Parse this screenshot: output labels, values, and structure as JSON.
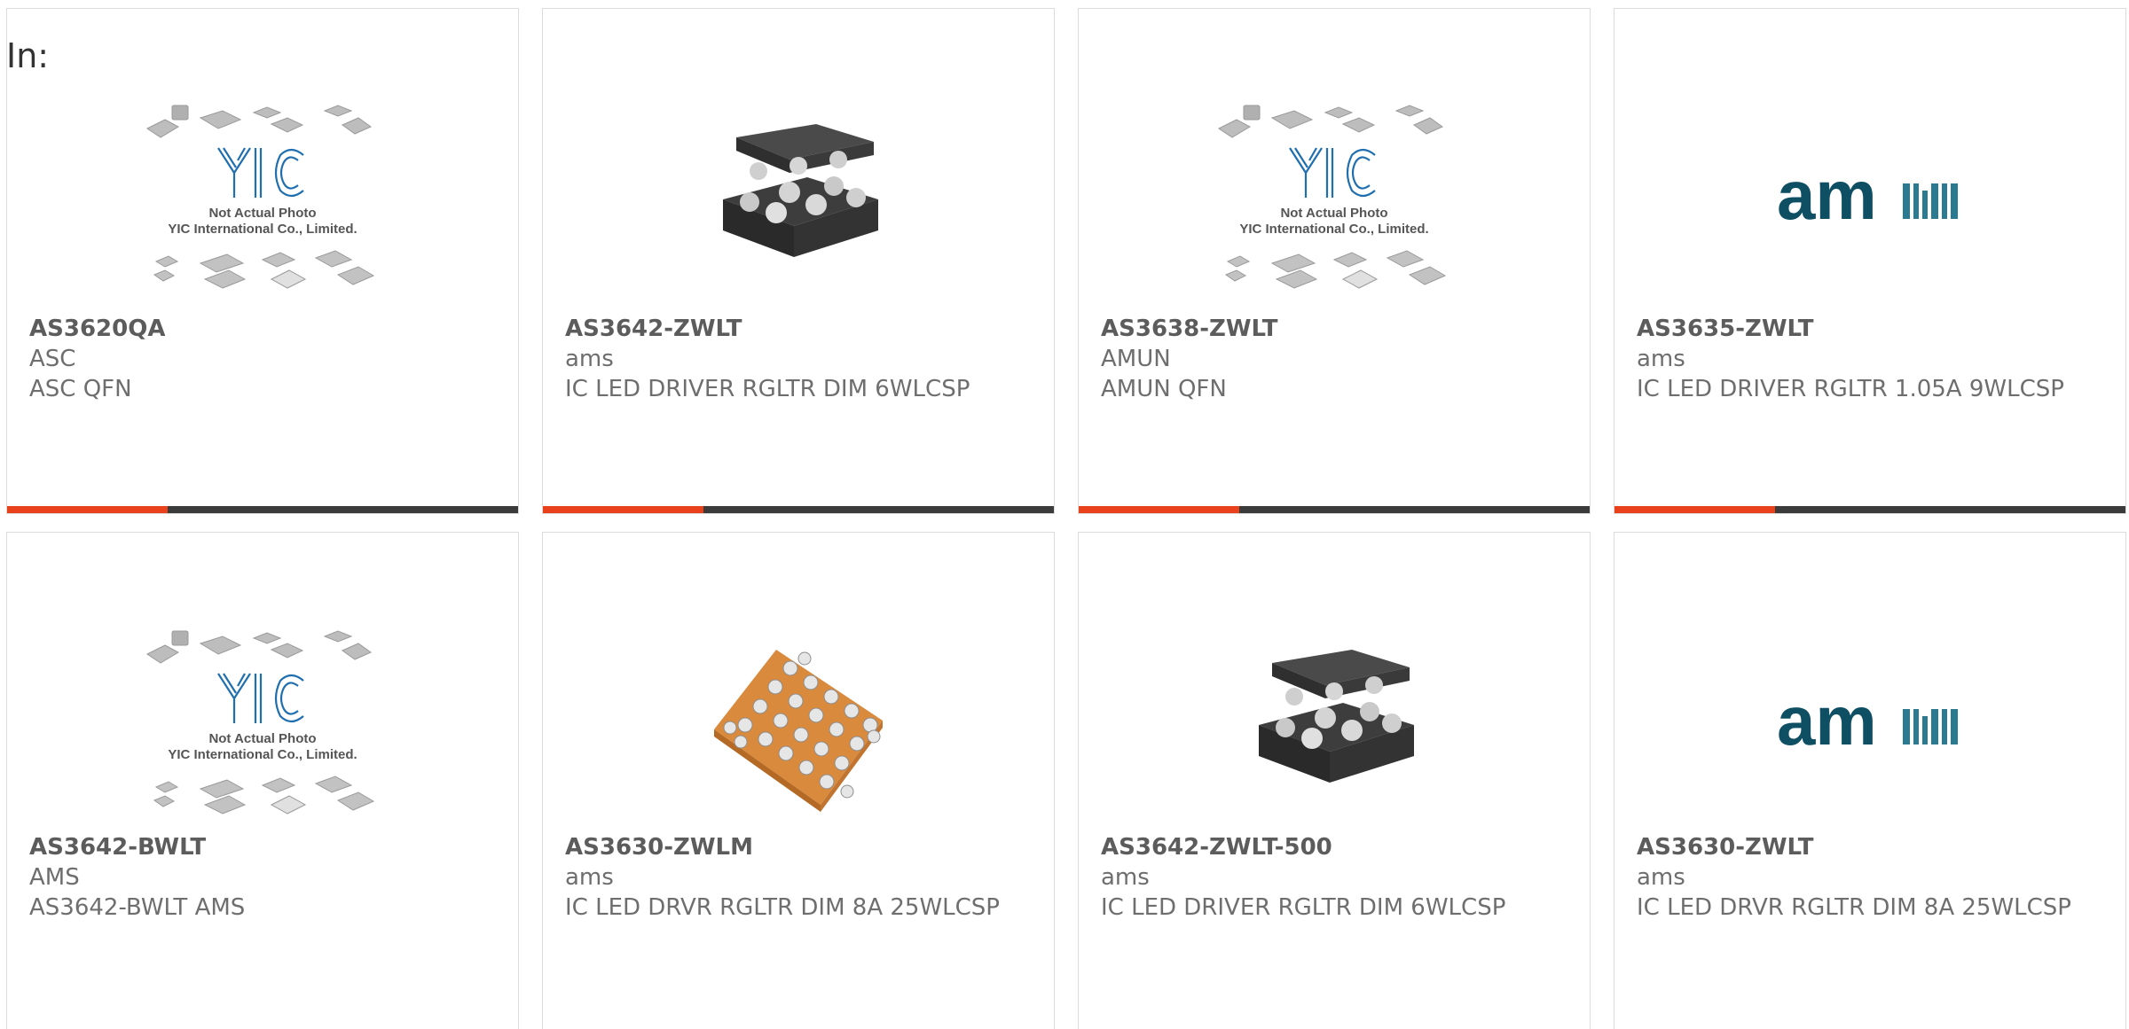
{
  "header": {
    "label": "In:"
  },
  "colors": {
    "accent": "#e8411c",
    "bar": "#3b3b3b",
    "text": "#6e6e6e"
  },
  "cards": [
    {
      "part": "AS3620QA",
      "mfr": "ASC",
      "desc": "ASC QFN",
      "image": "yic-placeholder",
      "placeholder_text_1": "Not Actual Photo",
      "placeholder_text_2": "YIC International Co., Limited.",
      "logo": "YIC"
    },
    {
      "part": "AS3642-ZWLT",
      "mfr": "ams",
      "desc": "IC LED DRIVER RGLTR DIM 6WLCSP",
      "image": "wlcsp-6-chip"
    },
    {
      "part": "AS3638-ZWLT",
      "mfr": "AMUN",
      "desc": "AMUN QFN",
      "image": "yic-placeholder",
      "placeholder_text_1": "Not Actual Photo",
      "placeholder_text_2": "YIC International Co., Limited.",
      "logo": "YIC"
    },
    {
      "part": "AS3635-ZWLT",
      "mfr": "ams",
      "desc": "IC LED DRIVER RGLTR 1.05A 9WLCSP",
      "image": "ams-logo",
      "logo": "am"
    },
    {
      "part": "AS3642-BWLT",
      "mfr": "AMS",
      "desc": "AS3642-BWLT AMS",
      "image": "yic-placeholder",
      "placeholder_text_1": "Not Actual Photo",
      "placeholder_text_2": "YIC International Co., Limited.",
      "logo": "YIC"
    },
    {
      "part": "AS3630-ZWLM",
      "mfr": "ams",
      "desc": "IC LED DRVR RGLTR DIM 8A 25WLCSP",
      "image": "wlcsp-25-chip"
    },
    {
      "part": "AS3642-ZWLT-500",
      "mfr": "ams",
      "desc": "IC LED DRIVER RGLTR DIM 6WLCSP",
      "image": "wlcsp-6-chip"
    },
    {
      "part": "AS3630-ZWLT",
      "mfr": "ams",
      "desc": "IC LED DRVR RGLTR DIM 8A 25WLCSP",
      "image": "ams-logo",
      "logo": "am"
    }
  ]
}
